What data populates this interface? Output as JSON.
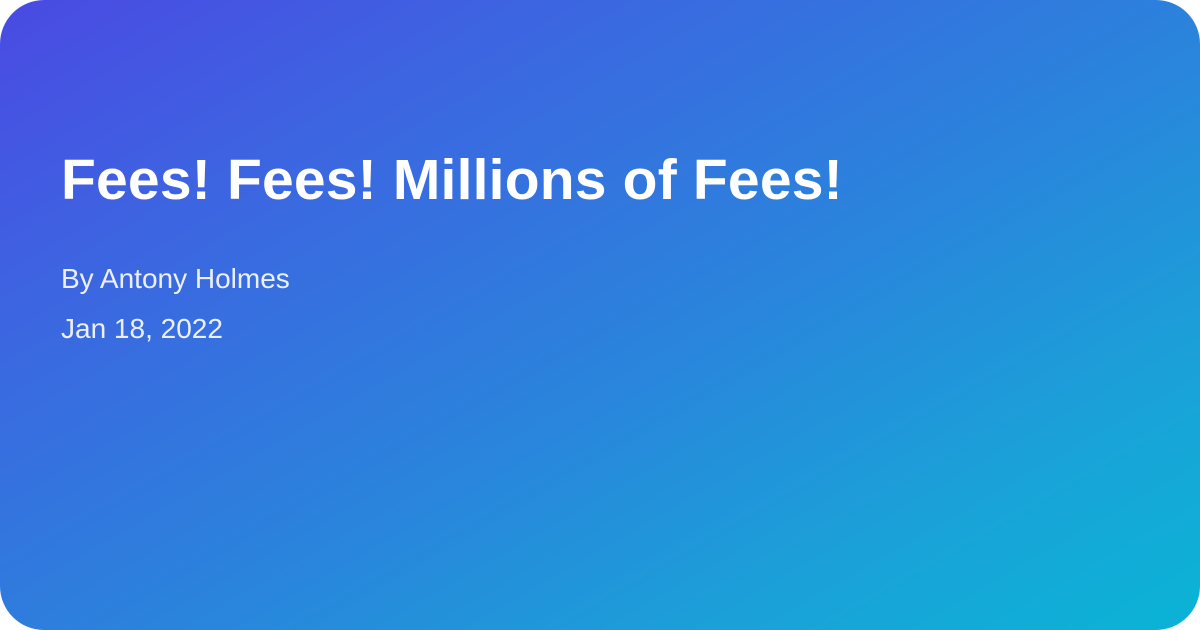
{
  "post": {
    "title": "Fees! Fees! Millions of Fees!",
    "author_line": "By Antony Holmes",
    "date": "Jan 18, 2022"
  },
  "colors": {
    "gradient_start": "#4a4ae2",
    "gradient_end": "#0ab4d6",
    "text": "#ffffff"
  }
}
